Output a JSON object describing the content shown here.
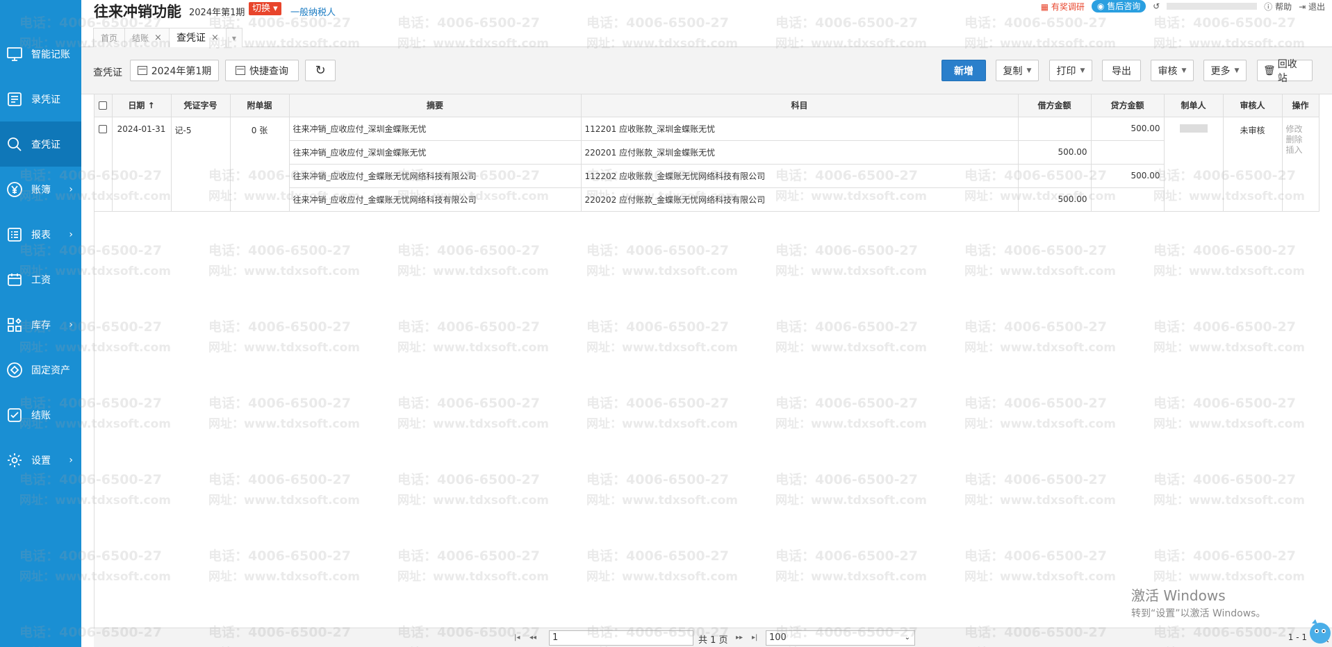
{
  "header": {
    "title": "往来冲销功能",
    "period": "2024年第1期",
    "switch_label": "切换",
    "taxpayer": "一般纳税人",
    "links": {
      "research": "有奖调研",
      "service": "售后咨询",
      "help": "帮助",
      "logout": "退出"
    }
  },
  "tabs": [
    {
      "label": "首页"
    },
    {
      "label": "结账"
    },
    {
      "label": "查凭证"
    }
  ],
  "sidebar": {
    "items": [
      {
        "label": "智能记账",
        "icon": "monitor-icon"
      },
      {
        "label": "录凭证",
        "icon": "voucher-entry-icon"
      },
      {
        "label": "查凭证",
        "icon": "search-icon"
      },
      {
        "label": "账簿",
        "icon": "yen-icon"
      },
      {
        "label": "报表",
        "icon": "report-icon"
      },
      {
        "label": "工资",
        "icon": "salary-icon"
      },
      {
        "label": "库存",
        "icon": "inventory-icon"
      },
      {
        "label": "固定资产",
        "icon": "asset-icon"
      },
      {
        "label": "结账",
        "icon": "checkout-icon"
      },
      {
        "label": "设置",
        "icon": "gear-icon"
      }
    ]
  },
  "toolbar": {
    "label": "查凭证",
    "period_btn": "2024年第1期",
    "quick_query": "快捷查询",
    "new": "新增",
    "copy": "复制",
    "print": "打印",
    "export": "导出",
    "audit": "审核",
    "more": "更多",
    "recycle": "回收站"
  },
  "table": {
    "headers": {
      "date": "日期",
      "voucher_no": "凭证字号",
      "attachments": "附单据",
      "summary": "摘要",
      "account": "科目",
      "debit": "借方金额",
      "credit": "贷方金额",
      "maker": "制单人",
      "auditor": "审核人",
      "ops": "操作"
    },
    "voucher": {
      "date": "2024-01-31",
      "voucher_no": "记-5",
      "attachments": "0 张",
      "audit_status": "未审核",
      "ops": [
        "修改",
        "删除",
        "插入"
      ],
      "lines": [
        {
          "summary": "往来冲销_应收应付_深圳金蝶账无忧",
          "account": "112201 应收账款_深圳金蝶账无忧",
          "debit": "",
          "credit": "500.00"
        },
        {
          "summary": "往来冲销_应收应付_深圳金蝶账无忧",
          "account": "220201 应付账款_深圳金蝶账无忧",
          "debit": "500.00",
          "credit": ""
        },
        {
          "summary": "往来冲销_应收应付_金蝶账无忧网络科技有限公司",
          "account": "112202 应收账款_金蝶账无忧网络科技有限公司",
          "debit": "",
          "credit": "500.00"
        },
        {
          "summary": "往来冲销_应收应付_金蝶账无忧网络科技有限公司",
          "account": "220202 应付账款_金蝶账无忧网络科技有限公司",
          "debit": "500.00",
          "credit": ""
        }
      ]
    }
  },
  "pager": {
    "page": "1",
    "total_pages": "共 1 页",
    "page_size": "100",
    "range": "1 - 1",
    "total": "共"
  },
  "watermark": {
    "phone": "电话：4006-6500-27",
    "site": "网址：www.tdxsoft.com"
  },
  "windows": {
    "line1": "激活 Windows",
    "line2": "转到“设置”以激活 Windows。"
  },
  "colors": {
    "sidebar": "#1a8fd3",
    "primary": "#2a7fcb",
    "switch": "#e8452c"
  }
}
